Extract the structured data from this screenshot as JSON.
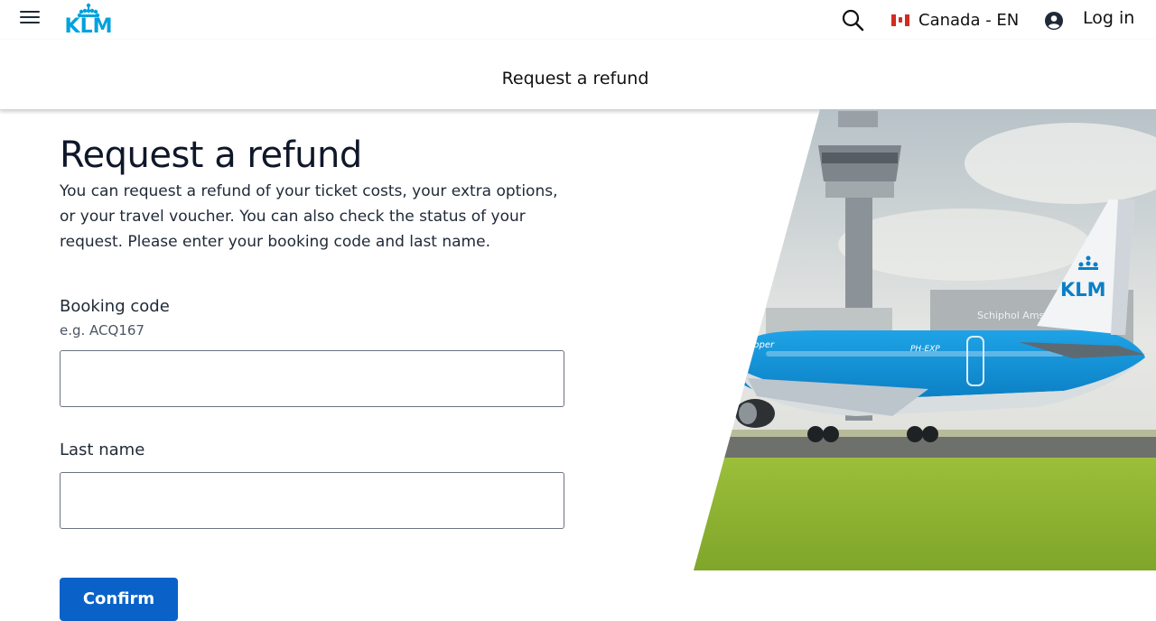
{
  "header": {
    "logo_text": "KLM",
    "locale_label": "Canada - EN",
    "login_label": "Log in"
  },
  "subheader": {
    "title": "Request a refund"
  },
  "main": {
    "title": "Request a refund",
    "intro": "You can request a refund of your ticket costs, your extra options, or your travel voucher. You can also check the status of your request. Please enter your booking code and last name.",
    "booking_code": {
      "label": "Booking code",
      "hint": "e.g. ACQ167",
      "value": ""
    },
    "last_name": {
      "label": "Last name",
      "value": ""
    },
    "confirm_label": "Confirm"
  },
  "hero": {
    "tail_logo_text": "KLM",
    "building_sign": "Schiphol Amst",
    "registration": "PH-EXP",
    "fuselage_text": "opper"
  },
  "colors": {
    "brand_blue": "#00A1DE",
    "button_blue": "#0a62c8"
  }
}
